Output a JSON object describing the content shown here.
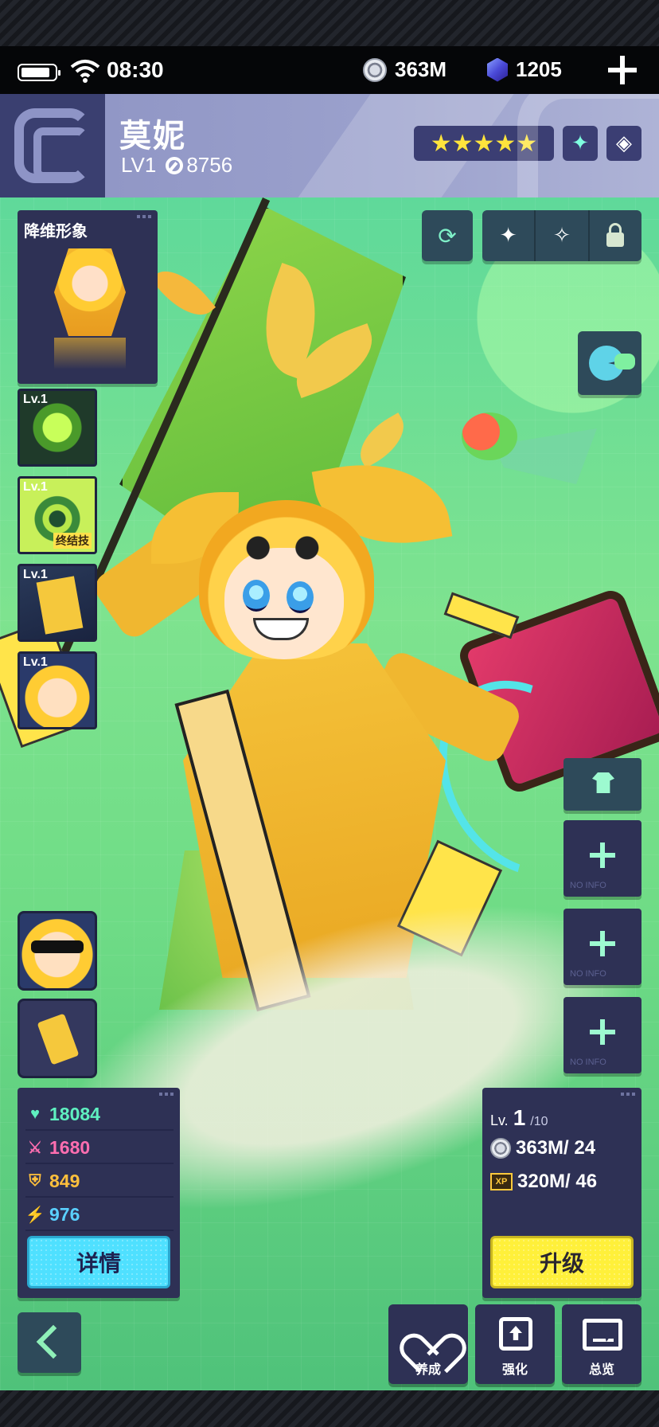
{
  "status_bar": {
    "time": "08:30",
    "coins": "363M",
    "gems": "1205"
  },
  "character": {
    "name": "莫妮",
    "level": "LV1",
    "power": "8756",
    "stars": "★★★★★"
  },
  "avatar_panel": {
    "title": "降维形象"
  },
  "skills": [
    {
      "level": "Lv.1",
      "tag": ""
    },
    {
      "level": "Lv.1",
      "tag": "终结技"
    },
    {
      "level": "Lv.1",
      "tag": ""
    },
    {
      "level": "Lv.1",
      "tag": ""
    }
  ],
  "equipment": {
    "empty_label": "NO INFO"
  },
  "stats": {
    "hp": "18084",
    "attack": "1680",
    "defense": "849",
    "speed": "976",
    "detail_button": "详情"
  },
  "upgrade": {
    "lv_prefix": "Lv.",
    "level": "1",
    "max_level": "/10",
    "coin_cost": "363M/ 24",
    "xp_label": "XP",
    "xp_cost": "320M/ 46",
    "upgrade_button": "升级"
  },
  "bottom_nav": {
    "cultivate": "养成",
    "enhance": "强化",
    "overview": "总览"
  },
  "colors": {
    "panel": "#2e3155",
    "accent_cyan": "#4fe0ff",
    "accent_yellow": "#fff03a",
    "star": "#ffe43c"
  }
}
